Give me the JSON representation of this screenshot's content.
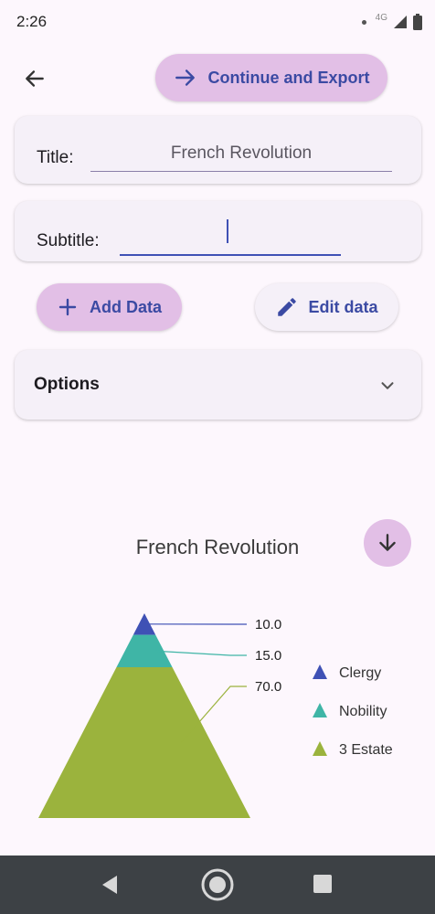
{
  "status_bar": {
    "time": "2:26",
    "network": "4G"
  },
  "header": {
    "export_label": "Continue and Export"
  },
  "title_field": {
    "label": "Title:",
    "value": "French Revolution"
  },
  "subtitle_field": {
    "label": "Subtitle:",
    "value": ""
  },
  "actions": {
    "add_data_label": "Add Data",
    "edit_data_label": "Edit data"
  },
  "options": {
    "label": "Options"
  },
  "chart_data": {
    "type": "pyramid",
    "title": "French Revolution",
    "categories": [
      "Clergy",
      "Nobility",
      "3 Estate"
    ],
    "values": [
      10.0,
      15.0,
      70.0
    ],
    "value_labels": [
      "10.0",
      "15.0",
      "70.0"
    ],
    "colors": [
      "#3f51b5",
      "#3fb5a6",
      "#9bb33d"
    ],
    "legend_placement": "right"
  },
  "colors": {
    "accent": "#3b4aa3",
    "button_fill": "#e2bfe6",
    "surface": "#f5f0f8"
  },
  "icons": {
    "back": "arrow-left-icon",
    "export": "arrow-right-icon",
    "add": "plus-icon",
    "edit": "pencil-icon",
    "chevron": "chevron-down-icon",
    "download": "arrow-down-icon"
  }
}
